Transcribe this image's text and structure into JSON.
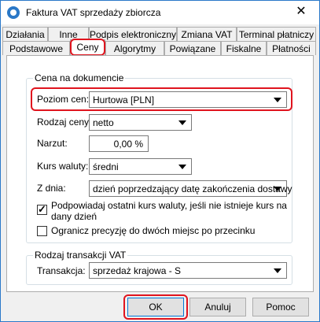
{
  "window": {
    "title": "Faktura VAT sprzedaży zbiorcza",
    "close_glyph": "✕"
  },
  "tabs_row1": [
    "Działania",
    "Inne",
    "Podpis elektroniczny",
    "Zmiana VAT",
    "Terminal płatniczy"
  ],
  "tabs_row2": [
    "Podstawowe",
    "Ceny",
    "Algorytmy",
    "Powiązane",
    "Fiskalne",
    "Płatności"
  ],
  "active_tab": "Ceny",
  "price_group": {
    "title": "Cena na dokumencie",
    "price_level": {
      "label": "Poziom cen:",
      "value": "Hurtowa [PLN]"
    },
    "price_type": {
      "label": "Rodzaj ceny:",
      "value": "netto"
    },
    "markup": {
      "label": "Narzut:",
      "value": "0,00 %"
    },
    "exchange_rate": {
      "label": "Kurs waluty:",
      "value": "średni"
    },
    "from_day": {
      "label": "Z dnia:",
      "value": "dzień poprzedzający datę zakończenia dostawy"
    },
    "checkbox_rate": {
      "label_line1": "Podpowiadaj ostatni kurs waluty, jeśli nie istnieje kurs na",
      "label_line2": "dany dzień",
      "checked": true
    },
    "checkbox_precision": {
      "label": "Ogranicz precyzję do dwóch miejsc po przecinku",
      "checked": false
    }
  },
  "vat_group": {
    "title": "Rodzaj transakcji VAT",
    "transaction": {
      "label": "Transakcja:",
      "value": "sprzedaż krajowa - S"
    }
  },
  "buttons": {
    "ok": "OK",
    "cancel": "Anuluj",
    "help": "Pomoc"
  },
  "colors": {
    "highlight": "#e0141e",
    "title_icon": "#2a78c7"
  }
}
